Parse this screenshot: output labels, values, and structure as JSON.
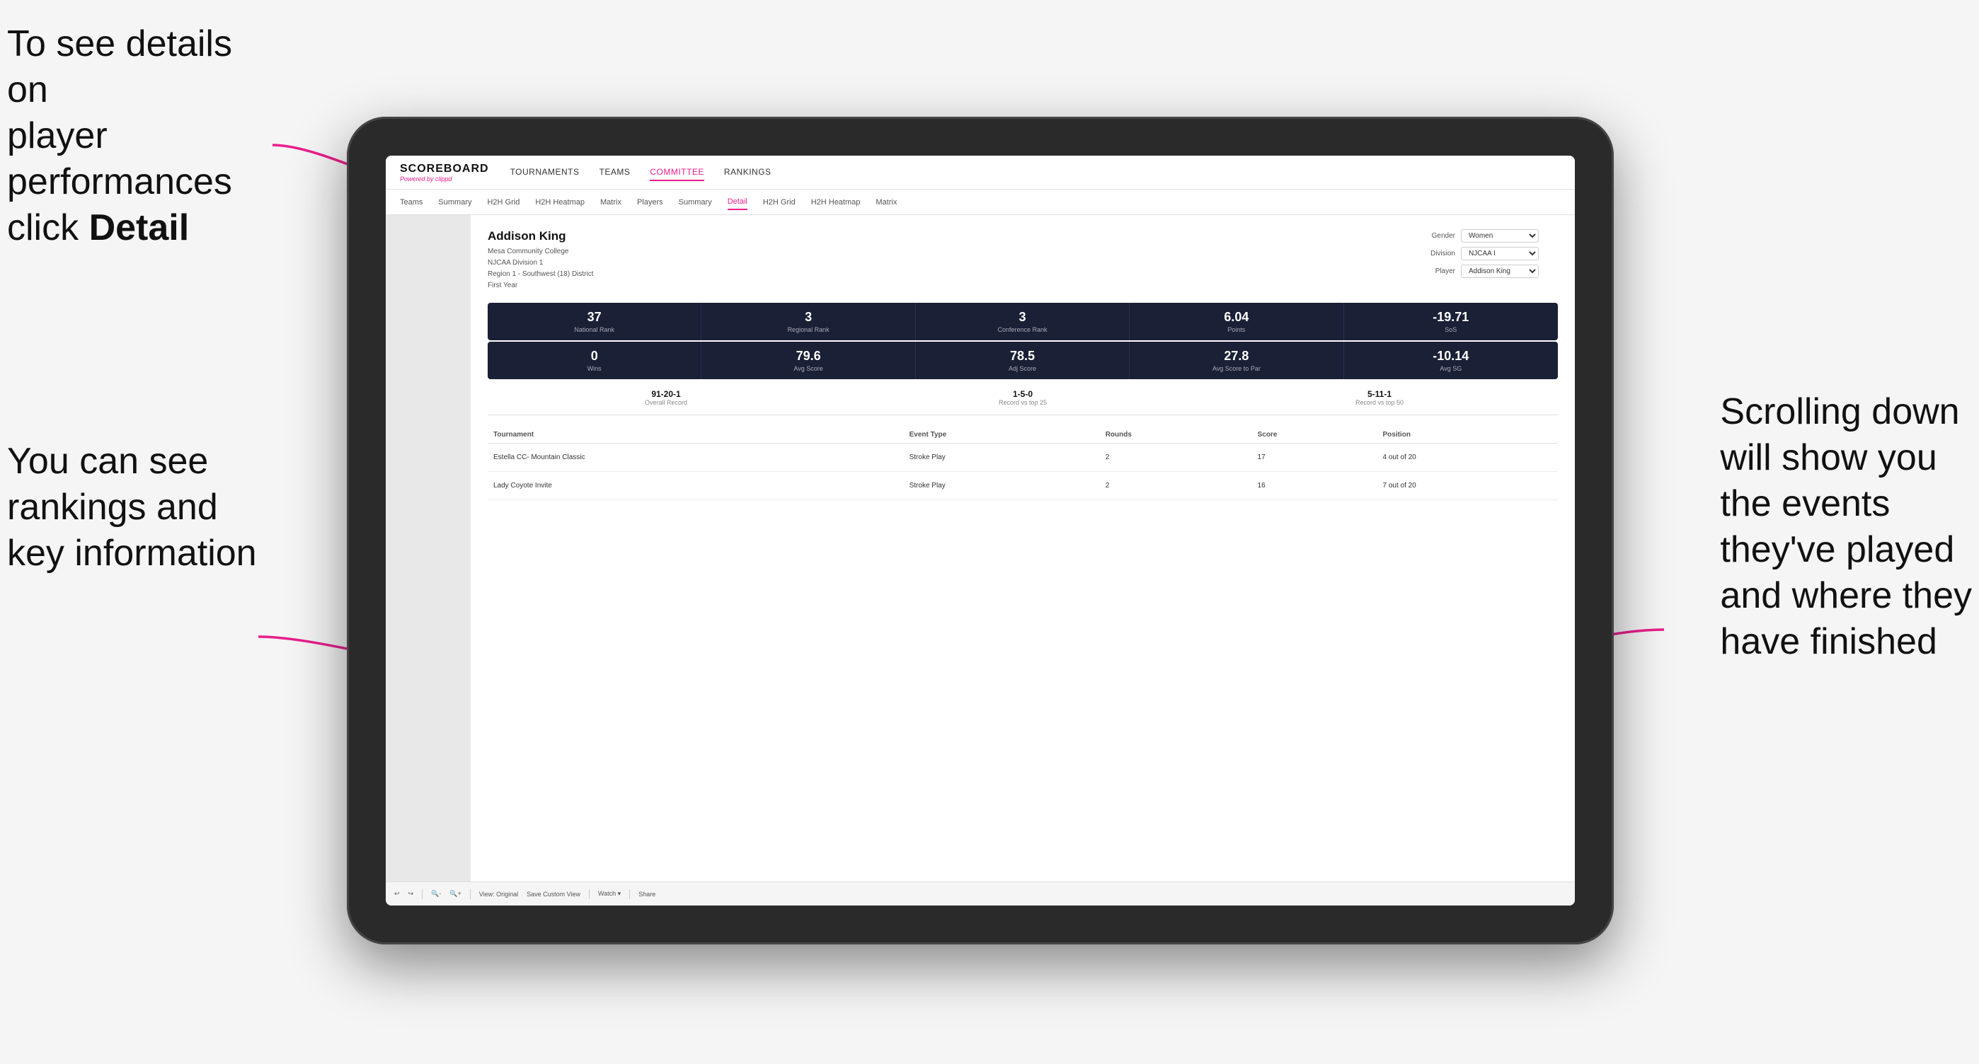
{
  "annotations": {
    "topleft_line1": "To see details on",
    "topleft_line2": "player performances",
    "topleft_line3": "click ",
    "topleft_bold": "Detail",
    "bottomleft_line1": "You can see",
    "bottomleft_line2": "rankings and",
    "bottomleft_line3": "key information",
    "right_line1": "Scrolling down",
    "right_line2": "will show you",
    "right_line3": "the events",
    "right_line4": "they've played",
    "right_line5": "and where they",
    "right_line6": "have finished"
  },
  "nav": {
    "logo": "SCOREBOARD",
    "powered_by": "Powered by",
    "clippd": "clippd",
    "items": [
      "TOURNAMENTS",
      "TEAMS",
      "COMMITTEE",
      "RANKINGS"
    ]
  },
  "subnav": {
    "items": [
      "Teams",
      "Summary",
      "H2H Grid",
      "H2H Heatmap",
      "Matrix",
      "Players",
      "Summary",
      "Detail",
      "H2H Grid",
      "H2H Heatmap",
      "Matrix"
    ]
  },
  "player": {
    "name": "Addison King",
    "college": "Mesa Community College",
    "division": "NJCAA Division 1",
    "region": "Region 1 - Southwest (18) District",
    "year": "First Year"
  },
  "controls": {
    "gender_label": "Gender",
    "gender_value": "Women",
    "division_label": "Division",
    "division_value": "NJCAA I",
    "player_label": "Player",
    "player_value": "Addison King"
  },
  "stats_row1": [
    {
      "value": "37",
      "label": "National Rank"
    },
    {
      "value": "3",
      "label": "Regional Rank"
    },
    {
      "value": "3",
      "label": "Conference Rank"
    },
    {
      "value": "6.04",
      "label": "Points"
    },
    {
      "value": "-19.71",
      "label": "SoS"
    }
  ],
  "stats_row2": [
    {
      "value": "0",
      "label": "Wins"
    },
    {
      "value": "79.6",
      "label": "Avg Score"
    },
    {
      "value": "78.5",
      "label": "Adj Score"
    },
    {
      "value": "27.8",
      "label": "Avg Score to Par"
    },
    {
      "value": "-10.14",
      "label": "Avg SG"
    }
  ],
  "records": [
    {
      "value": "91-20-1",
      "label": "Overall Record"
    },
    {
      "value": "1-5-0",
      "label": "Record vs top 25"
    },
    {
      "value": "5-11-1",
      "label": "Record vs top 50"
    }
  ],
  "table": {
    "headers": [
      "Tournament",
      "Event Type",
      "Rounds",
      "Score",
      "Position"
    ],
    "rows": [
      {
        "tournament": "Estella CC- Mountain Classic",
        "event_type": "Stroke Play",
        "rounds": "2",
        "score": "17",
        "position": "4 out of 20"
      },
      {
        "tournament": "Lady Coyote Invite",
        "event_type": "Stroke Play",
        "rounds": "2",
        "score": "16",
        "position": "7 out of 20"
      }
    ]
  },
  "toolbar": {
    "buttons": [
      "View: Original",
      "Save Custom View",
      "Watch ▾",
      "Share"
    ]
  }
}
